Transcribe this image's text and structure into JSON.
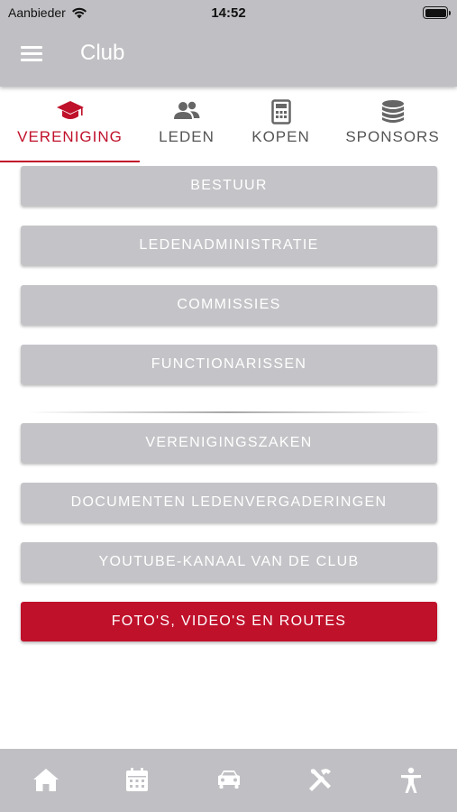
{
  "status_bar": {
    "carrier": "Aanbieder",
    "time": "14:52"
  },
  "header": {
    "title": "Club",
    "menu_icon": "hamburger-menu-icon"
  },
  "tabs": [
    {
      "label": "VERENIGING",
      "icon": "graduation-cap-icon",
      "active": true
    },
    {
      "label": "LEDEN",
      "icon": "users-icon",
      "active": false
    },
    {
      "label": "KOPEN",
      "icon": "calculator-icon",
      "active": false
    },
    {
      "label": "SPONSORS",
      "icon": "coins-stack-icon",
      "active": false
    }
  ],
  "buttons": [
    {
      "label": "BESTUUR"
    },
    {
      "label": "LEDENADMINISTRATIE"
    },
    {
      "label": "COMMISSIES"
    },
    {
      "label": "FUNCTIONARISSEN"
    },
    {
      "label": "VERENIGINGSZAKEN"
    },
    {
      "label": "DOCUMENTEN LEDENVERGADERINGEN"
    },
    {
      "label": "YOUTUBE-KANAAL VAN DE CLUB"
    },
    {
      "label": "FOTO'S, VIDEO'S EN ROUTES"
    }
  ],
  "bottom_nav": [
    {
      "icon": "home-icon"
    },
    {
      "icon": "calendar-icon"
    },
    {
      "icon": "car-icon"
    },
    {
      "icon": "tools-icon"
    },
    {
      "icon": "accessibility-icon"
    }
  ],
  "colors": {
    "accent": "#c0112b",
    "header_bg": "#c0c0c4",
    "button_bg": "#c4c4c8"
  }
}
